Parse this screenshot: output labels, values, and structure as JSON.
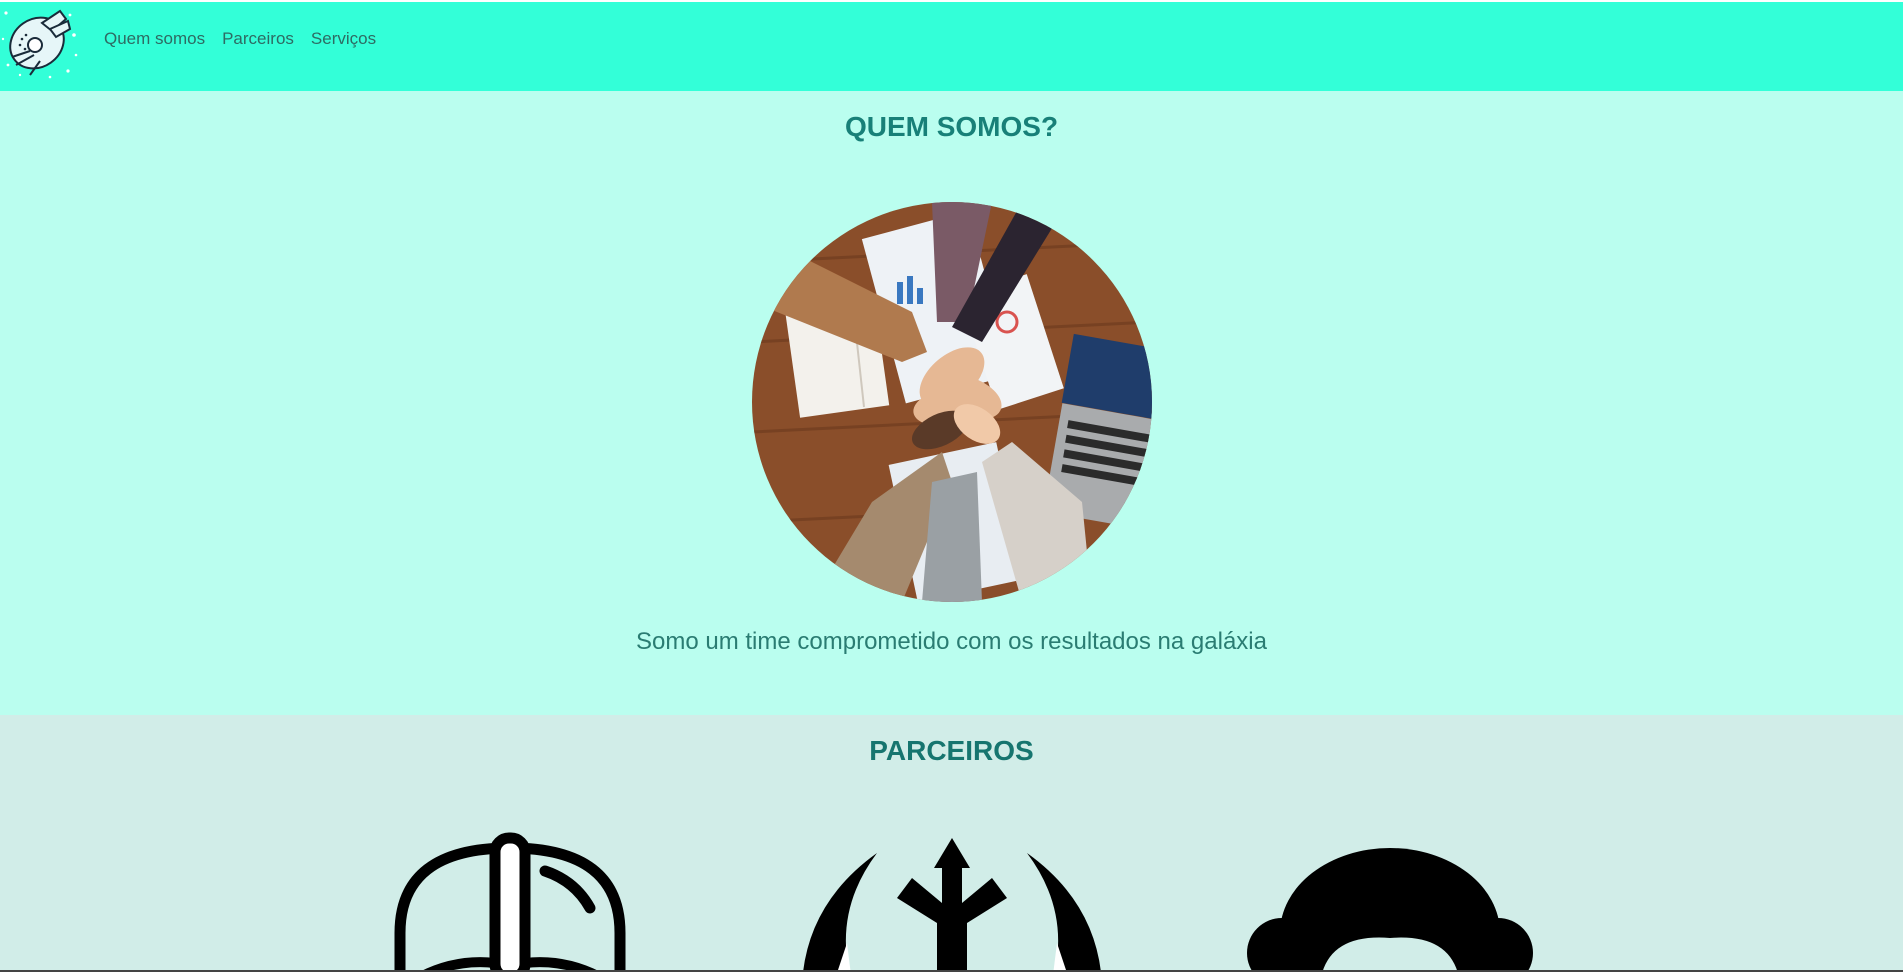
{
  "header": {
    "logo_icon": "millennium-falcon-icon",
    "nav": [
      {
        "label": "Quem somos"
      },
      {
        "label": "Parceiros"
      },
      {
        "label": "Serviços"
      }
    ],
    "background": "#33ffd8"
  },
  "quem": {
    "title": "QUEM SOMOS?",
    "photo_icon": "team-hands-photo",
    "text": "Somo um time comprometido com os resultados na galáxia",
    "background": "#bafeef"
  },
  "parceiros": {
    "title": "PARCEIROS",
    "logos": [
      "darth-vader-helmet-icon",
      "rebel-alliance-icon",
      "princess-leia-icon"
    ],
    "background": "#d1ede8"
  }
}
